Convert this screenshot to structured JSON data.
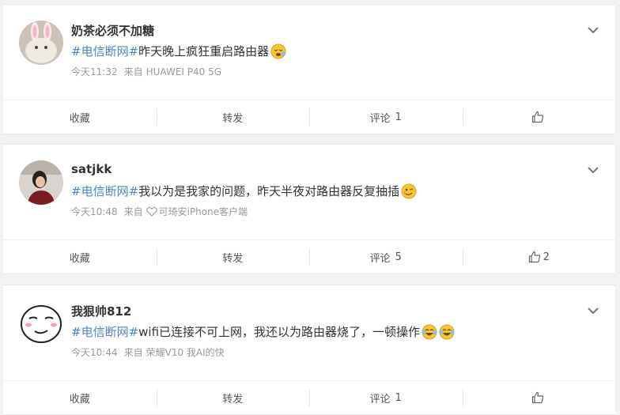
{
  "posts": [
    {
      "username": "奶茶必须不加糖",
      "topic": "#电信断网#",
      "text": "昨天晚上疯狂重启路由器",
      "emojis": [
        "sleepy-emoji"
      ],
      "time": "今天11:32",
      "source_prefix": "来自",
      "source": "HUAWEI P40 5G",
      "actions": {
        "favorite": "收藏",
        "repost": "转发",
        "comment": "评论",
        "comment_count": "1",
        "like_count": ""
      }
    },
    {
      "username": "satjkk",
      "topic": "#电信断网#",
      "text": "我以为是我家的问题，昨天半夜对路由器反复抽插",
      "emojis": [
        "wink-emoji"
      ],
      "time": "今天10:48",
      "source_prefix": "来自",
      "source": "可琦安iPhone客户端",
      "actions": {
        "favorite": "收藏",
        "repost": "转发",
        "comment": "评论",
        "comment_count": "5",
        "like_count": "2"
      }
    },
    {
      "username": "我狠帅812",
      "topic": "#电信断网#",
      "text": "wifi已连接不可上网，我还以为路由器烧了，一顿操作",
      "emojis": [
        "laugh-cry-emoji",
        "laugh-cry-emoji"
      ],
      "time": "今天10:44",
      "source_prefix": "来自",
      "source": "荣耀V10 我AI的快",
      "actions": {
        "favorite": "收藏",
        "repost": "转发",
        "comment": "评论",
        "comment_count": "1",
        "like_count": ""
      }
    }
  ],
  "colors": {
    "topic": "#4a86c5",
    "meta": "#999999",
    "background": "#f2f2f2"
  }
}
